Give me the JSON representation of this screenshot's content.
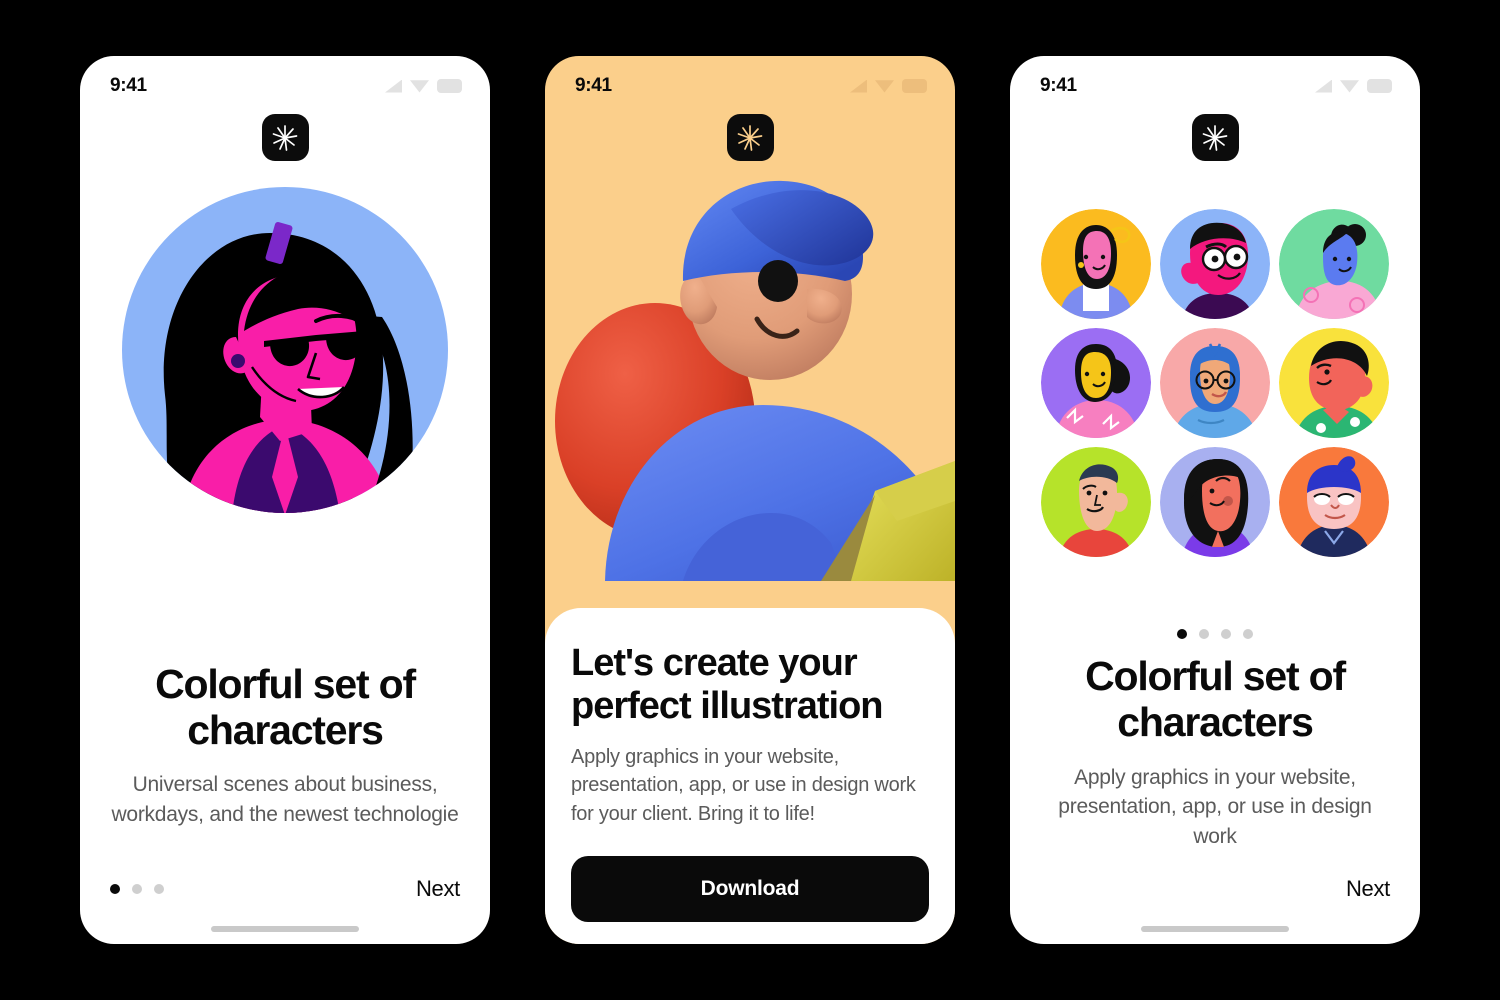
{
  "app": {
    "background_color": "#000000",
    "logo_icon": "starburst-icon"
  },
  "screens": [
    {
      "id": "screen-characters",
      "background": "#ffffff",
      "status_bar": {
        "time": "9:41",
        "icons": [
          "signal-icon",
          "wifi-icon",
          "battery-icon"
        ]
      },
      "illustration": {
        "name": "woman-with-sunglasses-avatar",
        "circle_color": "#8CB4F8",
        "skin_color": "#F91EA8",
        "hair_color": "#000000",
        "clip_color": "#7B28C9",
        "jacket_color": "#3B0A6E"
      },
      "headline": "Colorful set of characters",
      "subtext": "Universal scenes about business, workdays, and the newest technologie",
      "dots": {
        "count": 3,
        "active": 0
      },
      "next_label": "Next",
      "has_home_indicator": true
    },
    {
      "id": "screen-create",
      "background": "#FBCF8B",
      "status_bar": {
        "time": "9:41",
        "icons": [
          "signal-icon",
          "wifi-icon",
          "battery-icon"
        ]
      },
      "illustration": {
        "name": "3d-character-with-map",
        "cap_color": "#3D63D8",
        "shirt_color": "#4D74E8",
        "backpack_color": "#D93B26",
        "skin_color": "#E8A483",
        "map_color": "#D9D053"
      },
      "headline": "Let's create your perfect illustration",
      "subtext": "Apply graphics in your website, presentation, app, or use in design work for your client. Bring it to life!",
      "cta_label": "Download",
      "has_home_indicator": false
    },
    {
      "id": "screen-gallery",
      "background": "#ffffff",
      "status_bar": {
        "time": "9:41",
        "icons": [
          "signal-icon",
          "wifi-icon",
          "battery-icon"
        ]
      },
      "avatars": [
        {
          "name": "avatar-woman-yellow",
          "bg": "#FBBB1F",
          "skin": "#F472B6",
          "hair": "#111111",
          "cloth": "#7C8CF0"
        },
        {
          "name": "avatar-man-glasses-blue",
          "bg": "#8CB4F8",
          "skin": "#F4187E",
          "hair": "#111111",
          "cloth": "#3B0A52"
        },
        {
          "name": "avatar-woman-bun-green",
          "bg": "#6FDBA0",
          "skin": "#5B7BF0",
          "hair": "#111111",
          "cloth": "#F9A8D4"
        },
        {
          "name": "avatar-woman-ponytail-purple",
          "bg": "#9B6EF3",
          "skin": "#F5C518",
          "hair": "#111111",
          "cloth": "#F77FC0"
        },
        {
          "name": "avatar-woman-blue-hair-pink",
          "bg": "#F8A8A8",
          "skin": "#F0A878",
          "hair": "#2F6FD0",
          "cloth": "#5FA8E8"
        },
        {
          "name": "avatar-man-yellow-bg",
          "bg": "#F9E23C",
          "skin": "#F2645A",
          "hair": "#111111",
          "cloth": "#2BB673"
        },
        {
          "name": "avatar-man-lime",
          "bg": "#B6E32A",
          "skin": "#F2B89B",
          "hair": "#2B3A52",
          "cloth": "#E8453C"
        },
        {
          "name": "avatar-woman-periwinkle",
          "bg": "#A8B0F0",
          "skin": "#F2705E",
          "hair": "#111111",
          "cloth": "#7B3BE8"
        },
        {
          "name": "avatar-person-orange",
          "bg": "#F9793C",
          "skin": "#F9C3C3",
          "hair": "#2B35C9",
          "cloth": "#1F2A5E"
        }
      ],
      "dots": {
        "count": 4,
        "active": 0
      },
      "headline": "Colorful set of characters",
      "subtext": "Apply graphics in your website, presentation, app, or use in design work",
      "next_label": "Next",
      "has_home_indicator": true
    }
  ]
}
